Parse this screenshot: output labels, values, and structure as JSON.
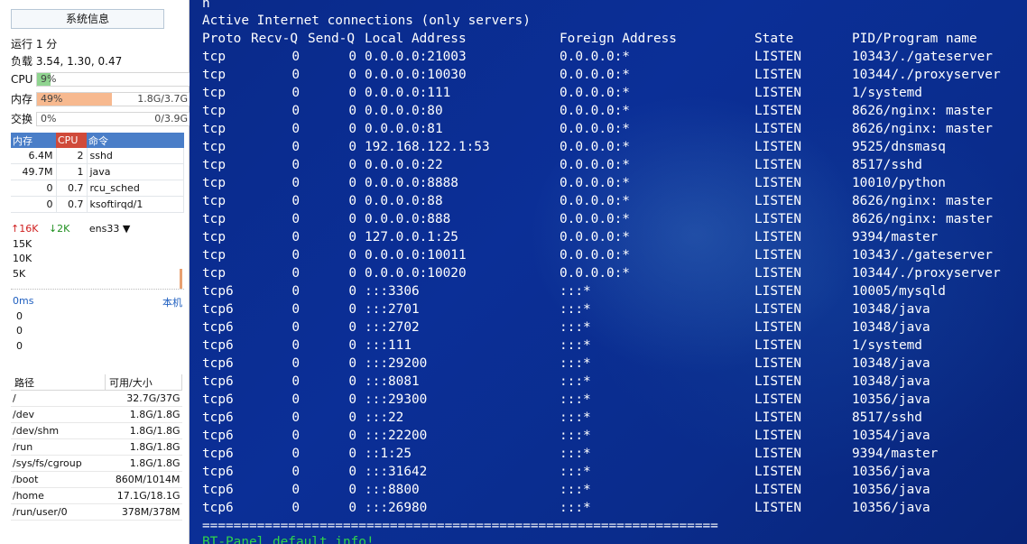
{
  "sidebar": {
    "sys_info_button": "系统信息",
    "uptime": "运行 1 分",
    "load": "负载 3.54, 1.30, 0.47",
    "cpu": {
      "label": "CPU",
      "pct": "9%",
      "fraction": 0.09,
      "color": "#8fd48f"
    },
    "mem": {
      "label": "内存",
      "pct": "49%",
      "fraction": 0.49,
      "total": "1.8G/3.7G",
      "color": "#f7b98f"
    },
    "swap": {
      "label": "交换",
      "pct": "0%",
      "fraction": 0.0,
      "total": "0/3.9G",
      "color": "#cccccc"
    },
    "process_table": {
      "headers": [
        "内存",
        "CPU",
        "命令"
      ],
      "header_colors": [
        "#4a7ec8",
        "#d04a3a",
        "#4a7ec8"
      ],
      "rows": [
        [
          "6.4M",
          "2",
          "sshd"
        ],
        [
          "49.7M",
          "1",
          "java"
        ],
        [
          "0",
          "0.7",
          "rcu_sched"
        ],
        [
          "0",
          "0.7",
          "ksoftirqd/1"
        ]
      ]
    },
    "network": {
      "up": "16K",
      "down": "2K",
      "interface": "ens33",
      "scale": [
        "15K",
        "10K",
        "5K"
      ]
    },
    "latency": {
      "label": "0ms",
      "host": "本机",
      "values": [
        "0",
        "0",
        "0"
      ]
    },
    "disk_table": {
      "headers": [
        "路径",
        "可用/大小"
      ],
      "rows": [
        [
          "/",
          "32.7G/37G"
        ],
        [
          "/dev",
          "1.8G/1.8G"
        ],
        [
          "/dev/shm",
          "1.8G/1.8G"
        ],
        [
          "/run",
          "1.8G/1.8G"
        ],
        [
          "/sys/fs/cgroup",
          "1.8G/1.8G"
        ],
        [
          "/boot",
          "860M/1014M"
        ],
        [
          "/home",
          "17.1G/18.1G"
        ],
        [
          "/run/user/0",
          "378M/378M"
        ]
      ]
    }
  },
  "terminal": {
    "prompt_fragment": "n",
    "title": "Active Internet connections (only servers)",
    "headers": [
      "Proto",
      "Recv-Q",
      "Send-Q",
      "Local Address",
      "Foreign Address",
      "State",
      "PID/Program name"
    ],
    "rows": [
      [
        "tcp",
        "0",
        "0",
        "0.0.0.0:21003",
        "0.0.0.0:*",
        "LISTEN",
        "10343/./gateserver"
      ],
      [
        "tcp",
        "0",
        "0",
        "0.0.0.0:10030",
        "0.0.0.0:*",
        "LISTEN",
        "10344/./proxyserver"
      ],
      [
        "tcp",
        "0",
        "0",
        "0.0.0.0:111",
        "0.0.0.0:*",
        "LISTEN",
        "1/systemd"
      ],
      [
        "tcp",
        "0",
        "0",
        "0.0.0.0:80",
        "0.0.0.0:*",
        "LISTEN",
        "8626/nginx: master"
      ],
      [
        "tcp",
        "0",
        "0",
        "0.0.0.0:81",
        "0.0.0.0:*",
        "LISTEN",
        "8626/nginx: master"
      ],
      [
        "tcp",
        "0",
        "0",
        "192.168.122.1:53",
        "0.0.0.0:*",
        "LISTEN",
        "9525/dnsmasq"
      ],
      [
        "tcp",
        "0",
        "0",
        "0.0.0.0:22",
        "0.0.0.0:*",
        "LISTEN",
        "8517/sshd"
      ],
      [
        "tcp",
        "0",
        "0",
        "0.0.0.0:8888",
        "0.0.0.0:*",
        "LISTEN",
        "10010/python"
      ],
      [
        "tcp",
        "0",
        "0",
        "0.0.0.0:88",
        "0.0.0.0:*",
        "LISTEN",
        "8626/nginx: master"
      ],
      [
        "tcp",
        "0",
        "0",
        "0.0.0.0:888",
        "0.0.0.0:*",
        "LISTEN",
        "8626/nginx: master"
      ],
      [
        "tcp",
        "0",
        "0",
        "127.0.0.1:25",
        "0.0.0.0:*",
        "LISTEN",
        "9394/master"
      ],
      [
        "tcp",
        "0",
        "0",
        "0.0.0.0:10011",
        "0.0.0.0:*",
        "LISTEN",
        "10343/./gateserver"
      ],
      [
        "tcp",
        "0",
        "0",
        "0.0.0.0:10020",
        "0.0.0.0:*",
        "LISTEN",
        "10344/./proxyserver"
      ],
      [
        "tcp6",
        "0",
        "0",
        ":::3306",
        ":::*",
        "LISTEN",
        "10005/mysqld"
      ],
      [
        "tcp6",
        "0",
        "0",
        ":::2701",
        ":::*",
        "LISTEN",
        "10348/java"
      ],
      [
        "tcp6",
        "0",
        "0",
        ":::2702",
        ":::*",
        "LISTEN",
        "10348/java"
      ],
      [
        "tcp6",
        "0",
        "0",
        ":::111",
        ":::*",
        "LISTEN",
        "1/systemd"
      ],
      [
        "tcp6",
        "0",
        "0",
        ":::29200",
        ":::*",
        "LISTEN",
        "10348/java"
      ],
      [
        "tcp6",
        "0",
        "0",
        ":::8081",
        ":::*",
        "LISTEN",
        "10348/java"
      ],
      [
        "tcp6",
        "0",
        "0",
        ":::29300",
        ":::*",
        "LISTEN",
        "10356/java"
      ],
      [
        "tcp6",
        "0",
        "0",
        ":::22",
        ":::*",
        "LISTEN",
        "8517/sshd"
      ],
      [
        "tcp6",
        "0",
        "0",
        ":::22200",
        ":::*",
        "LISTEN",
        "10354/java"
      ],
      [
        "tcp6",
        "0",
        "0",
        "::1:25",
        ":::*",
        "LISTEN",
        "9394/master"
      ],
      [
        "tcp6",
        "0",
        "0",
        ":::31642",
        ":::*",
        "LISTEN",
        "10356/java"
      ],
      [
        "tcp6",
        "0",
        "0",
        ":::8800",
        ":::*",
        "LISTEN",
        "10356/java"
      ],
      [
        "tcp6",
        "0",
        "0",
        ":::26980",
        ":::*",
        "LISTEN",
        "10356/java"
      ]
    ],
    "separator": "==================================================================",
    "footer": "BT-Panel default info!"
  }
}
